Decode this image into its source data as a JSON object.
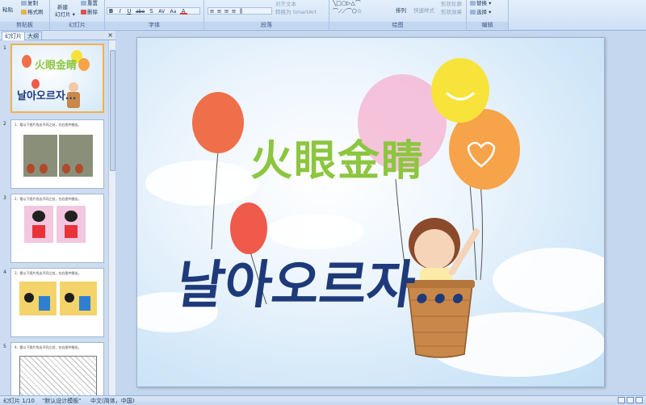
{
  "ribbon": {
    "clipboard": {
      "paste": "粘贴",
      "copy": "复制",
      "format_painter": "格式刷",
      "label": "剪贴板"
    },
    "slides": {
      "new_slide": "新建",
      "new_slide2": "幻灯片",
      "delete": "删除",
      "reset": "重置",
      "label": "幻灯片"
    },
    "font": {
      "label": "字体",
      "bold": "B",
      "italic": "I",
      "underline": "U",
      "strike": "abe",
      "shadow": "S",
      "spacing": "AV",
      "case": "Aa",
      "color": "A"
    },
    "paragraph": {
      "convert_smartart": "转换为 SmartArt",
      "text_direction": "对齐文本",
      "label": "段落"
    },
    "drawing": {
      "arrange": "排列",
      "quick_styles": "快速样式",
      "shape_effects": "形状效果",
      "shape_outline": "形状轮廓",
      "label": "绘图"
    },
    "editing": {
      "replace": "替换",
      "select": "选择",
      "label": "编辑"
    }
  },
  "pane": {
    "tab_slides": "幻灯片",
    "tab_outline": "大纲",
    "close": "×",
    "slides": [
      {
        "num": "1",
        "caption": ""
      },
      {
        "num": "2",
        "caption": "1、看以下图片找出不同之处，在右图中圈出。"
      },
      {
        "num": "3",
        "caption": "2、看以下图片找出不同之处，在右图中圈出。"
      },
      {
        "num": "4",
        "caption": "3、看以下图片找出不同之处，在右图中圈出。"
      },
      {
        "num": "5",
        "caption": "4、看以下图片找出不同之处，在右图中圈出。"
      }
    ],
    "thumb1_title": "火眼金睛",
    "thumb1_korean": "날아오르자..."
  },
  "slide": {
    "title": "火眼金睛",
    "korean_text": "날아오르자..."
  },
  "status": {
    "slide_pos": "幻灯片 1/10",
    "theme": "\"默认设计模板\"",
    "language": "中文(简体，中国)"
  },
  "colors": {
    "title_green": "#8cc63f",
    "korean_navy": "#1e3a7a",
    "selected_border": "#f0b24d"
  }
}
